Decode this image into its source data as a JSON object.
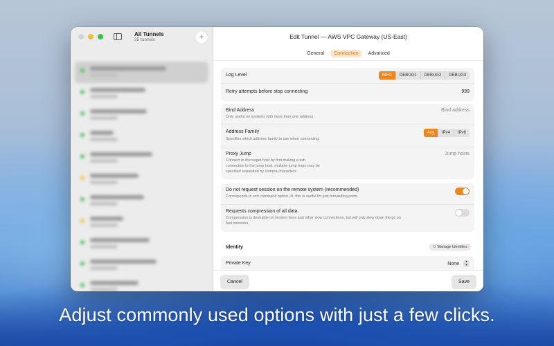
{
  "sidebar": {
    "title": "All Tunnels",
    "subtitle": "25 tunnels",
    "add_icon": "+",
    "items": [
      {
        "status": "green",
        "w": 110
      },
      {
        "status": "green",
        "w": 80
      },
      {
        "status": "green",
        "w": 82
      },
      {
        "status": "green",
        "w": 34
      },
      {
        "status": "green",
        "w": 90
      },
      {
        "status": "yellow",
        "w": 70
      },
      {
        "status": "green",
        "w": 78
      },
      {
        "status": "yellow",
        "w": 48
      },
      {
        "status": "green",
        "w": 86
      },
      {
        "status": "green",
        "w": 96
      },
      {
        "status": "green",
        "w": 70
      }
    ]
  },
  "editor": {
    "title": "Edit Tunnel — AWS VPC Gateway (US-East)",
    "tabs": [
      {
        "label": "General",
        "active": false
      },
      {
        "label": "Connection",
        "active": true
      },
      {
        "label": "Advanced",
        "active": false
      }
    ],
    "log_level": {
      "label": "Log Level",
      "options": [
        "INFO",
        "DEBUG1",
        "DEBUG2",
        "DEBUG3"
      ],
      "selected": "INFO"
    },
    "retry": {
      "label": "Retry attempts before stop connecting",
      "value": "999"
    },
    "bind_address": {
      "label": "Bind Address",
      "desc": "Only useful on systems with more than one address.",
      "placeholder": "Bind address"
    },
    "address_family": {
      "label": "Address Family",
      "desc": "Specifies which address family to use when connecting.",
      "options": [
        "Any",
        "IPv4",
        "IPv6"
      ],
      "selected": "Any"
    },
    "proxy_jump": {
      "label": "Proxy Jump",
      "desc_lines": [
        "Connect to the target host by first making a ssh",
        "connection to the jump host, multiple jump hops may be",
        "specified separated by comma characters."
      ],
      "placeholder": "Jump hosts"
    },
    "no_session": {
      "label": "Do not request session on the remote system (recommended)",
      "desc": "Corresponds to ssh command option -N, this is useful for just forwarding ports.",
      "on": true
    },
    "compression": {
      "label": "Requests compression of all data",
      "desc_lines": [
        "Compression is desirable on modem lines and other slow connections, but will only slow down things on",
        "fast networks."
      ],
      "on": false
    },
    "identity": {
      "title": "Identity",
      "manage_label": "Manage Identities",
      "private_key_label": "Private Key",
      "private_key_value": "None"
    },
    "cancel_label": "Cancel",
    "save_label": "Save"
  },
  "caption": "Adjust commonly used options with just a few clicks.",
  "colors": {
    "accent": "#f0861a",
    "tab_active_bg": "#fde4cc"
  }
}
